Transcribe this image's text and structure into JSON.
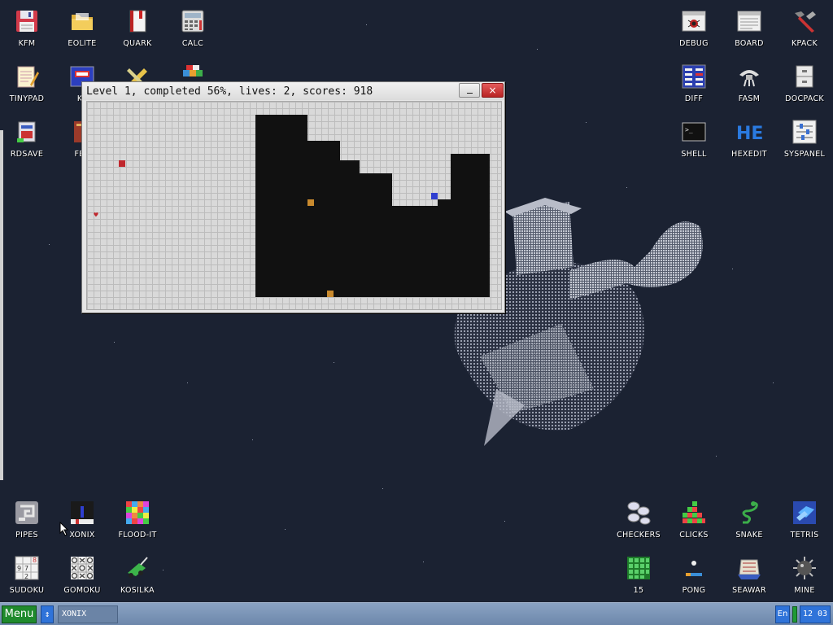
{
  "desktop": {
    "icons_top_left": [
      {
        "label": "KFM",
        "icon": "floppy-disk-icon"
      },
      {
        "label": "EOLITE",
        "icon": "folder-icon"
      },
      {
        "label": "QUARK",
        "icon": "notebook-icon"
      },
      {
        "label": "CALC",
        "icon": "calculator-icon"
      },
      {
        "label": "TINYPAD",
        "icon": "notepad-icon"
      },
      {
        "label": "KF",
        "icon": "blueprint-icon"
      },
      {
        "label": "",
        "icon": "pencil-ruler-icon"
      },
      {
        "label": "",
        "icon": "cubes-icon"
      },
      {
        "label": "RDSAVE",
        "icon": "ram-disk-save-icon"
      },
      {
        "label": "FB2",
        "icon": "book-icon"
      }
    ],
    "icons_top_right": [
      {
        "label": "DEBUG",
        "icon": "bug-window-icon"
      },
      {
        "label": "BOARD",
        "icon": "board-window-icon"
      },
      {
        "label": "KPACK",
        "icon": "hammer-wrench-icon"
      },
      {
        "label": "DIFF",
        "icon": "diff-table-icon"
      },
      {
        "label": "FASM",
        "icon": "assembler-icon"
      },
      {
        "label": "DOCPACK",
        "icon": "file-cabinet-icon"
      },
      {
        "label": "SHELL",
        "icon": "terminal-icon"
      },
      {
        "label": "HEXEDIT",
        "icon": "hex-editor-icon"
      },
      {
        "label": "SYSPANEL",
        "icon": "sliders-icon"
      }
    ],
    "icons_bottom_left": [
      {
        "label": "PIPES",
        "icon": "pipes-icon"
      },
      {
        "label": "XONIX",
        "icon": "xonix-icon"
      },
      {
        "label": "FLOOD-IT",
        "icon": "color-grid-icon"
      },
      {
        "label": "SUDOKU",
        "icon": "sudoku-icon"
      },
      {
        "label": "GOMOKU",
        "icon": "tic-tac-toe-icon"
      },
      {
        "label": "KOSILKA",
        "icon": "lawn-mower-icon"
      }
    ],
    "icons_bottom_right": [
      {
        "label": "CHECKERS",
        "icon": "checkers-icon"
      },
      {
        "label": "CLICKS",
        "icon": "blocks-icon"
      },
      {
        "label": "SNAKE",
        "icon": "snake-icon"
      },
      {
        "label": "TETRIS",
        "icon": "tetris-icon"
      },
      {
        "label": "15",
        "icon": "fifteen-puzzle-icon"
      },
      {
        "label": "PONG",
        "icon": "pong-icon"
      },
      {
        "label": "SEAWAR",
        "icon": "sea-battle-icon"
      },
      {
        "label": "MINE",
        "icon": "mine-icon"
      }
    ]
  },
  "window": {
    "title": "Level 1, completed 56%, lives: 2, scores: 918",
    "minimize_symbol": "–",
    "close_symbol": "×",
    "game": {
      "level": 1,
      "completed_percent": 56,
      "lives": 2,
      "score": 918
    }
  },
  "taskbar": {
    "menu_label": "Menu",
    "switch_symbol": "↕",
    "tasks": [
      "XONIX"
    ],
    "language": "En",
    "clock": "12 03"
  },
  "colors": {
    "desktop_bg": "#1b2232",
    "taskbar": "#7c95b8",
    "menu_button": "#1f8a2c",
    "accent_blue": "#2f73d9",
    "captured_area": "#111111",
    "field": "#d9d9d9",
    "enemy_orange": "#c98a2e",
    "player_blue": "#2f3fd0",
    "enemy_red": "#c0272d"
  }
}
